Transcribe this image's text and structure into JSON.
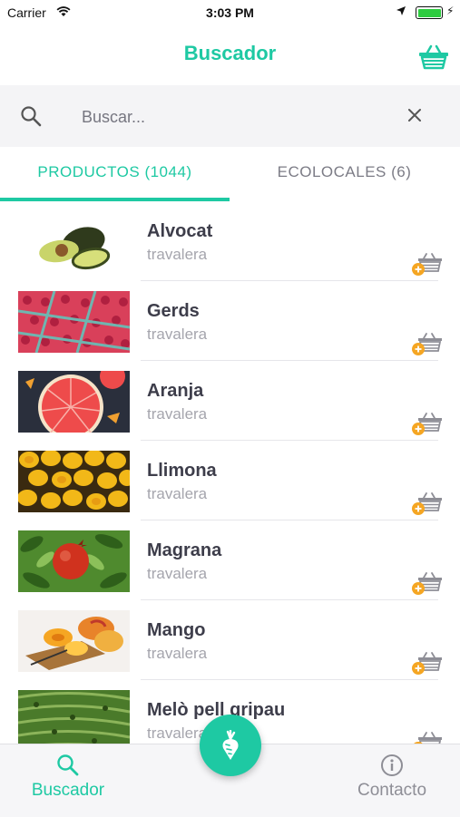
{
  "status_bar": {
    "carrier": "Carrier",
    "time": "3:03 PM"
  },
  "nav": {
    "title": "Buscador"
  },
  "search": {
    "placeholder": "Buscar..."
  },
  "tabs": [
    {
      "label": "PRODUCTOS (1044)",
      "active": true
    },
    {
      "label": "ECOLOCALES (6)",
      "active": false
    }
  ],
  "products": [
    {
      "name": "Alvocat",
      "seller": "travalera"
    },
    {
      "name": "Gerds",
      "seller": "travalera"
    },
    {
      "name": "Aranja",
      "seller": "travalera"
    },
    {
      "name": "Llimona",
      "seller": "travalera"
    },
    {
      "name": "Magrana",
      "seller": "travalera"
    },
    {
      "name": "Mango",
      "seller": "travalera"
    },
    {
      "name": "Melò pell gripau",
      "seller": "travalera"
    }
  ],
  "tab_bar": {
    "search_label": "Buscador",
    "contact_label": "Contacto"
  },
  "colors": {
    "accent": "#1ec9a3",
    "add_badge": "#f5a623",
    "text": "#3d3d4a",
    "muted": "#a5a5ad"
  }
}
